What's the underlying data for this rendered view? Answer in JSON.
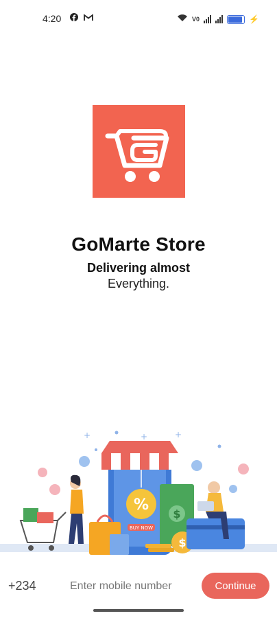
{
  "status": {
    "time": "4:20",
    "left_icons": [
      "facebook-icon",
      "gmail-icon"
    ],
    "right_icons": [
      "wifi-icon",
      "volte-icon",
      "signal-icon",
      "signal-icon",
      "battery-icon",
      "charging-icon"
    ]
  },
  "app": {
    "logo_icon": "cart-logo-icon",
    "logo_color": "#f26450",
    "title": "GoMarte Store",
    "tagline_line1": "Delivering almost",
    "tagline_line2": "Everything."
  },
  "hero": {
    "illustration": "online-shopping-illustration",
    "sale_badge": "%",
    "buy_button": "BUY NOW"
  },
  "login": {
    "country_code": "+234",
    "phone_placeholder": "Enter mobile number",
    "continue_label": "Continue",
    "accent": "#e9665c"
  }
}
